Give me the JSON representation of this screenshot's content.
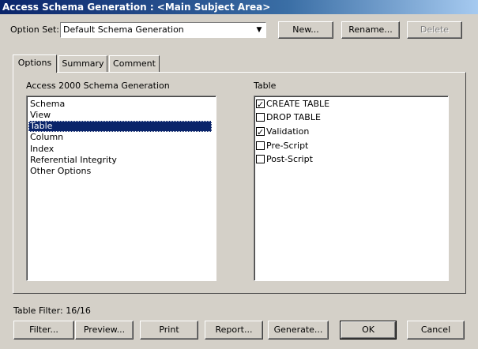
{
  "window": {
    "title": "Access Schema Generation : <Main Subject Area>"
  },
  "option_set": {
    "label": "Option Set:",
    "value": "Default Schema Generation",
    "new_label": "New...",
    "rename_label": "Rename...",
    "delete_label": "Delete"
  },
  "tabs": [
    {
      "label": "Options",
      "active": true
    },
    {
      "label": "Summary",
      "active": false
    },
    {
      "label": "Comment",
      "active": false
    }
  ],
  "left_list": {
    "heading": "Access 2000 Schema Generation",
    "items": [
      "Schema",
      "View",
      "Table",
      "Column",
      "Index",
      "Referential Integrity",
      "Other Options"
    ],
    "selected": "Table"
  },
  "right_list": {
    "heading": "Table",
    "items": [
      {
        "label": "CREATE TABLE",
        "checked": true
      },
      {
        "label": "DROP TABLE",
        "checked": false
      },
      {
        "label": "Validation",
        "checked": true
      },
      {
        "label": "Pre-Script",
        "checked": false
      },
      {
        "label": "Post-Script",
        "checked": false
      }
    ]
  },
  "status": {
    "filter_text": "Table Filter: 16/16"
  },
  "buttons": {
    "filter": "Filter...",
    "preview": "Preview...",
    "print": "Print",
    "report": "Report...",
    "generate": "Generate...",
    "ok": "OK",
    "cancel": "Cancel"
  }
}
